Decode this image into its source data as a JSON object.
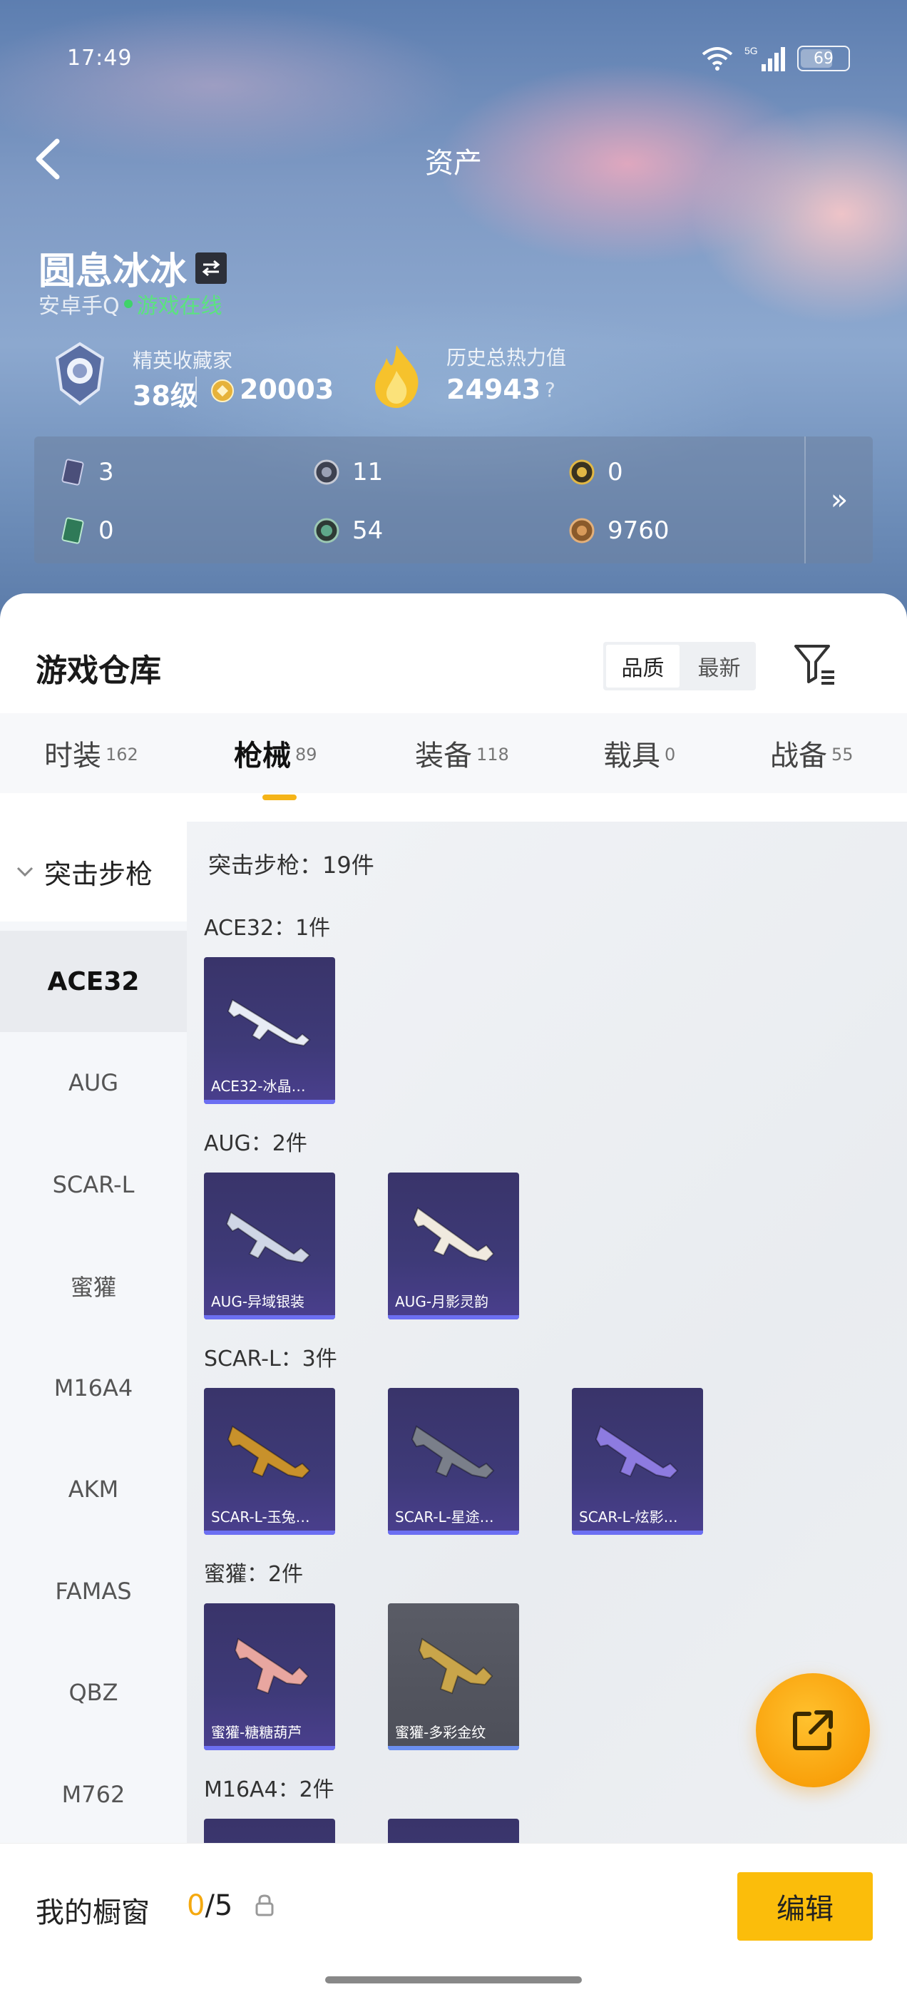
{
  "status": {
    "time": "17:49",
    "battery": "69",
    "battery_level": 0.69,
    "network": "5G"
  },
  "header": {
    "title": "资产"
  },
  "player": {
    "name": "圆息冰冰",
    "platform": "安卓手Q",
    "online_status": "游戏在线",
    "collector_title": "精英收藏家",
    "level": "38级",
    "points": "20003",
    "power_title": "历史总热力值",
    "power_value": "24943",
    "help": "?"
  },
  "resources": [
    {
      "icon": "ticket-icon",
      "value": "3"
    },
    {
      "icon": "token-icon",
      "value": "11"
    },
    {
      "icon": "gold-token-icon",
      "value": "0"
    },
    {
      "icon": "card-icon",
      "value": "0"
    },
    {
      "icon": "orb-icon",
      "value": "54"
    },
    {
      "icon": "bronze-coin-icon",
      "value": "9760"
    }
  ],
  "resources_expand": "»",
  "warehouse": {
    "title": "游戏仓库",
    "sort_options": [
      "品质",
      "最新"
    ],
    "active_sort": "品质"
  },
  "tabs": [
    {
      "label": "时装",
      "count": "162"
    },
    {
      "label": "枪械",
      "count": "89"
    },
    {
      "label": "装备",
      "count": "118"
    },
    {
      "label": "载具",
      "count": "0"
    },
    {
      "label": "战备",
      "count": "55"
    }
  ],
  "active_tab": "枪械",
  "sidebar": {
    "group": "突击步枪",
    "items": [
      "ACE32",
      "AUG",
      "SCAR-L",
      "蜜獾",
      "M16A4",
      "AKM",
      "FAMAS",
      "QBZ",
      "M762"
    ],
    "active": "ACE32"
  },
  "content": {
    "summary": "突击步枪：19件",
    "groups": [
      {
        "label": "ACE32：1件",
        "items": [
          {
            "name": "ACE32-冰晶…",
            "color": "#e8ecf5"
          }
        ]
      },
      {
        "label": "AUG：2件",
        "items": [
          {
            "name": "AUG-异域银装",
            "color": "#cfd6e6"
          },
          {
            "name": "AUG-月影灵韵",
            "color": "#f0eadf"
          }
        ]
      },
      {
        "label": "SCAR-L：3件",
        "items": [
          {
            "name": "SCAR-L-玉兔…",
            "color": "#c8912b"
          },
          {
            "name": "SCAR-L-星途…",
            "color": "#7a7f8a"
          },
          {
            "name": "SCAR-L-炫影…",
            "color": "#8d7be0"
          }
        ]
      },
      {
        "label": "蜜獾：2件",
        "items": [
          {
            "name": "蜜獾-糖糖葫芦",
            "color": "#e8a6a0"
          },
          {
            "name": "蜜獾-多彩金纹",
            "color": "#c9a54a"
          }
        ]
      },
      {
        "label": "M16A4：2件",
        "items": []
      }
    ]
  },
  "bottom": {
    "showcase_label": "我的橱窗",
    "showcase_current": "0",
    "showcase_total": "/5",
    "edit_label": "编辑"
  },
  "colors": {
    "accent": "#fbbd0b",
    "card_purple": "#3e3a78"
  }
}
